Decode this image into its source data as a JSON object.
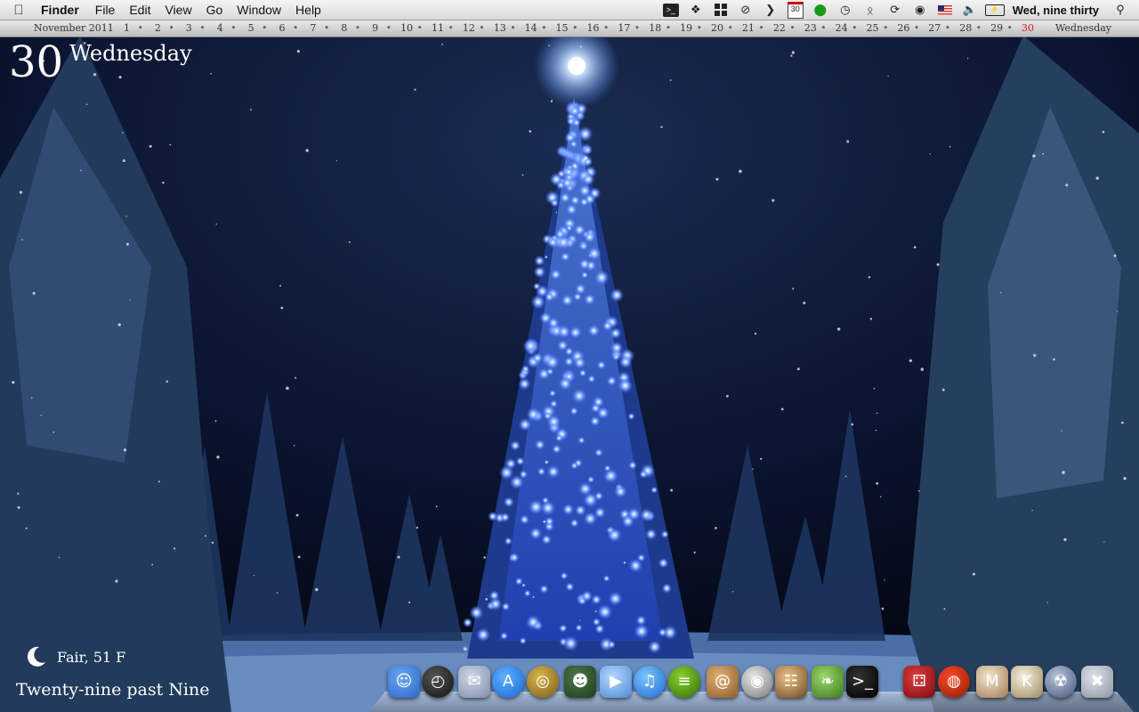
{
  "menubar": {
    "apple_icon": "apple-icon",
    "app_name": "Finder",
    "menus": [
      "File",
      "Edit",
      "View",
      "Go",
      "Window",
      "Help"
    ],
    "calendar_icon_day": "30",
    "clock": "Wed, nine thirty"
  },
  "datestrip": {
    "month_year": "November 2011",
    "days": [
      "1",
      "2",
      "3",
      "4",
      "5",
      "6",
      "7",
      "8",
      "9",
      "10",
      "11",
      "12",
      "13",
      "14",
      "15",
      "16",
      "17",
      "18",
      "19",
      "20",
      "21",
      "22",
      "23",
      "24",
      "25",
      "26",
      "27",
      "28",
      "29",
      "30"
    ],
    "today": "30",
    "weekday": "Wednesday",
    "today_color": "#d22222"
  },
  "desktop": {
    "big_date_number": "30",
    "big_date_day": "Wednesday",
    "weather": "Fair, 51 F",
    "time_text": "Twenty-nine past Nine"
  },
  "dock": {
    "apps": [
      {
        "name": "finder-icon"
      },
      {
        "name": "dashboard-icon"
      },
      {
        "name": "mail-stamp-icon"
      },
      {
        "name": "app-store-icon"
      },
      {
        "name": "dvd-player-icon"
      },
      {
        "name": "frankenstein-icon"
      },
      {
        "name": "facetime-icon"
      },
      {
        "name": "itunes-icon"
      },
      {
        "name": "spotify-icon"
      },
      {
        "name": "address-book-icon"
      },
      {
        "name": "itunes-dvd-icon"
      },
      {
        "name": "keynote-icon"
      },
      {
        "name": "evernote-icon"
      },
      {
        "name": "terminal-icon"
      },
      {
        "name": "dice-icon"
      },
      {
        "name": "drum-icon"
      },
      {
        "name": "mail-person-icon"
      },
      {
        "name": "k-app-icon"
      },
      {
        "name": "cd-burn-icon"
      },
      {
        "name": "trash-icon"
      }
    ]
  }
}
